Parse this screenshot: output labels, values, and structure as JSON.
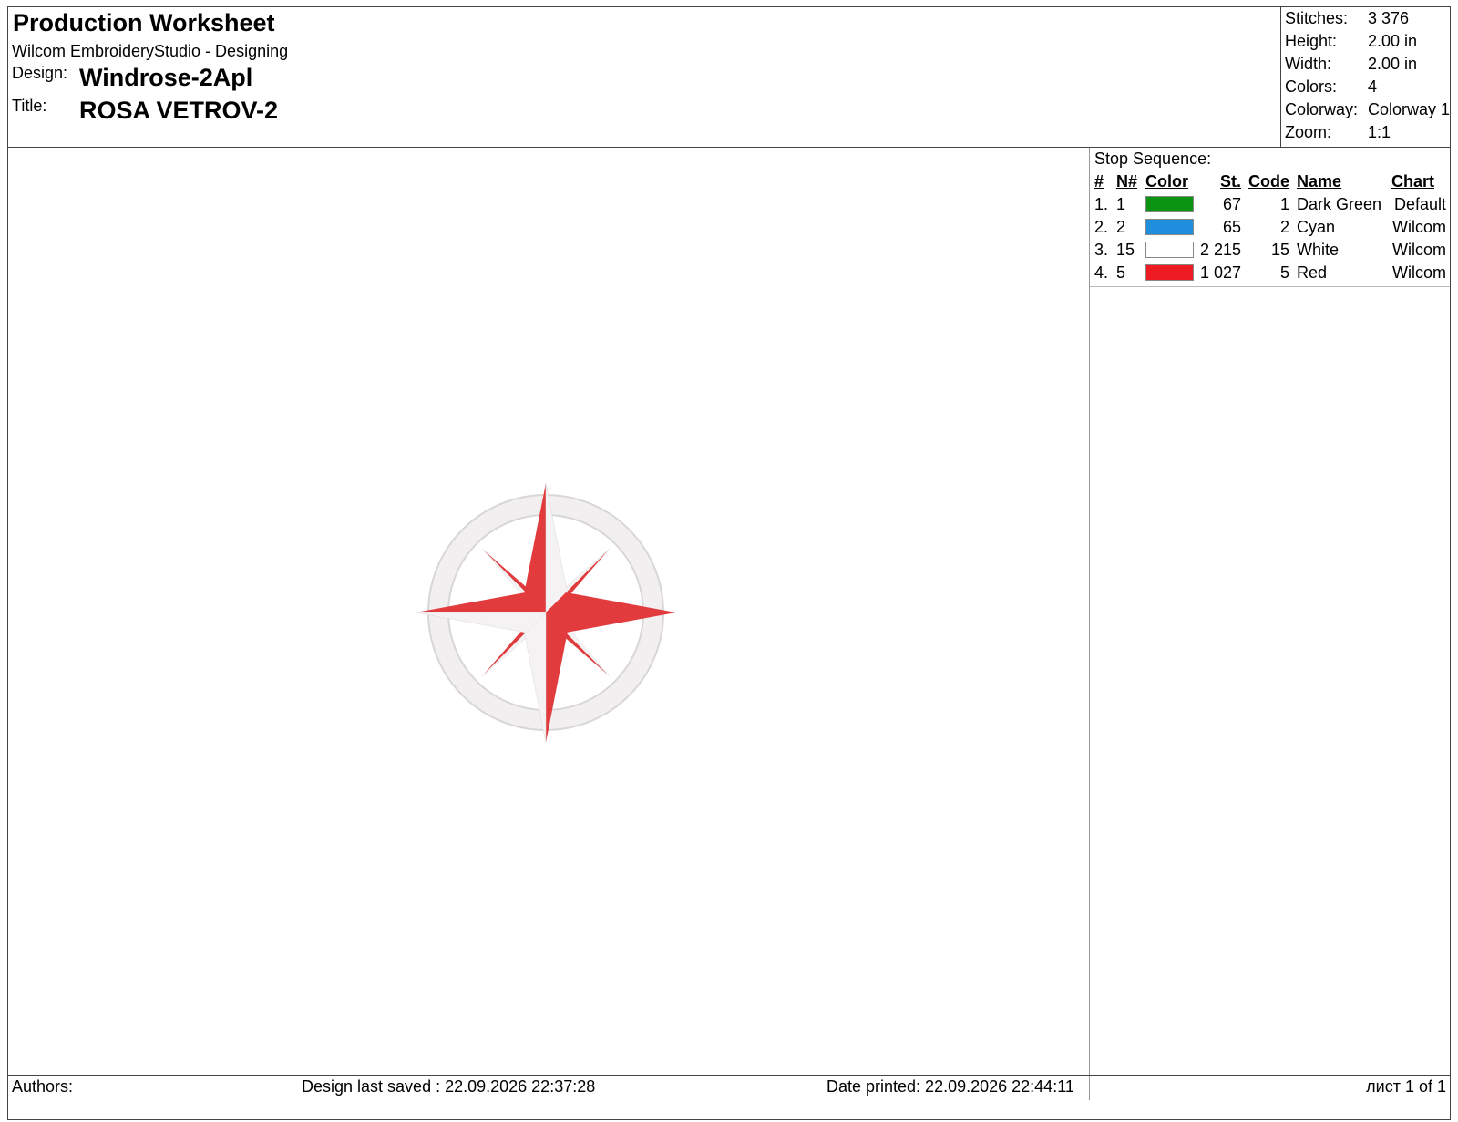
{
  "header": {
    "title": "Production Worksheet",
    "software": "Wilcom EmbroideryStudio - Designing",
    "design_label": "Design:",
    "design_value": "Windrose-2Apl",
    "title_label": "Title:",
    "title_value": "ROSA VETROV-2"
  },
  "stats": [
    {
      "label": "Stitches:",
      "value": "3 376"
    },
    {
      "label": "Height:",
      "value": "2.00 in"
    },
    {
      "label": "Width:",
      "value": "2.00 in"
    },
    {
      "label": "Colors:",
      "value": "4"
    },
    {
      "label": "Colorway:",
      "value": "Colorway 1"
    },
    {
      "label": "Zoom:",
      "value": "1:1"
    }
  ],
  "sequence": {
    "title": "Stop Sequence:",
    "columns": {
      "num": "#",
      "n": "N#",
      "color": "Color",
      "st": "St.",
      "code": "Code",
      "name": "Name",
      "chart": "Chart"
    },
    "rows": [
      {
        "num": "1.",
        "n": "1",
        "color": "#0a9412",
        "st": "67",
        "code": "1",
        "name": "Dark Green",
        "chart": "Default"
      },
      {
        "num": "2.",
        "n": "2",
        "color": "#1f8fdd",
        "st": "65",
        "code": "2",
        "name": "Cyan",
        "chart": "Wilcom"
      },
      {
        "num": "3.",
        "n": "15",
        "color": "#ffffff",
        "st": "2 215",
        "code": "15",
        "name": "White",
        "chart": "Wilcom"
      },
      {
        "num": "4.",
        "n": "5",
        "color": "#ee1c22",
        "st": "1 027",
        "code": "5",
        "name": "Red",
        "chart": "Wilcom"
      }
    ]
  },
  "design": {
    "icon": "compass-rose-icon",
    "ring_color": "#f1efef",
    "red": "#e23b3d",
    "white": "#f4f2f2"
  },
  "footer": {
    "authors": "Authors:",
    "last_saved": "Design last saved : 22.09.2026 22:37:28",
    "date_printed": "Date printed: 22.09.2026 22:44:11",
    "page": "лист 1 of 1"
  }
}
